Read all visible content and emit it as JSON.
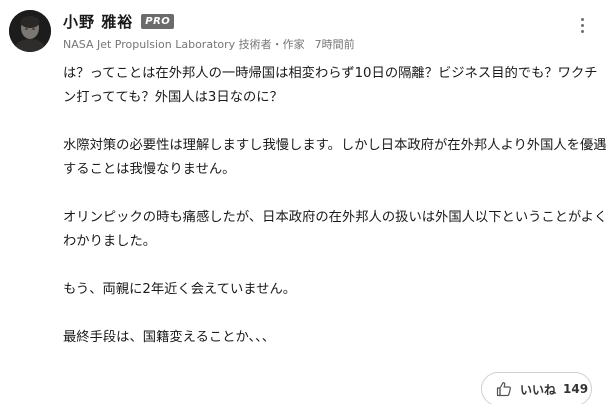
{
  "author": {
    "name": "小野 雅裕",
    "badge": "PRO",
    "affiliation": "NASA Jet Propulsion Laboratory 技術者・作家",
    "time": "7時間前"
  },
  "comment": {
    "paragraphs": [
      "は？ってことは在外邦人の一時帰国は相変わらず10日の隔離？ビジネス目的でも？ワクチン打ってても？外国人は3日なのに？",
      "水際対策の必要性は理解しますし我慢します。しかし日本政府が在外邦人より外国人を優遇することは我慢なりません。",
      "オリンピックの時も痛感したが、日本政府の在外邦人の扱いは外国人以下ということがよくわかりました。",
      "もう、両親に2年近く会えていません。",
      "最終手段は、国籍変えることか、、、"
    ]
  },
  "like": {
    "label": "いいね",
    "count": "149",
    "icon": "thumbs-up-icon"
  },
  "menu": {
    "icon": "more-vertical-icon"
  }
}
